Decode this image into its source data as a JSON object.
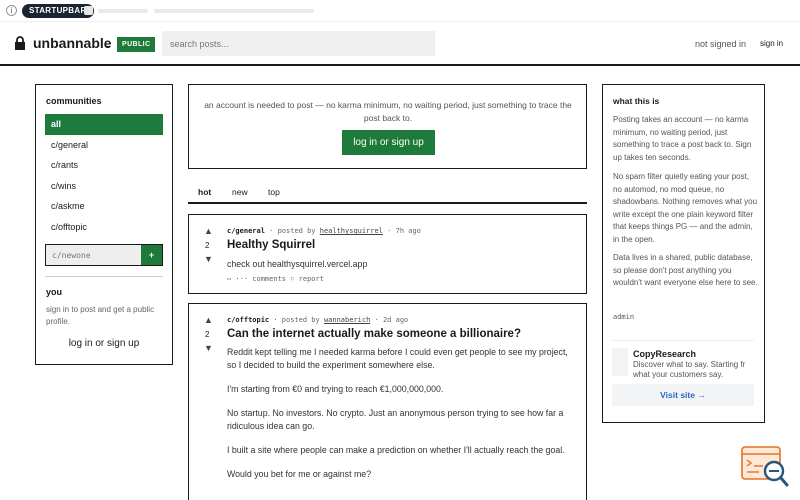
{
  "topbar": {
    "badge": "STARTUPBAR"
  },
  "header": {
    "site_name": "unbannable",
    "dot": ".",
    "public_badge": "PUBLIC",
    "search_placeholder": "search posts...",
    "status": "not signed in",
    "sign_in": "sign in"
  },
  "sidebar": {
    "title": "communities",
    "items": [
      {
        "label": "all",
        "active": true
      },
      {
        "label": "c/general"
      },
      {
        "label": "c/rants"
      },
      {
        "label": "c/wins"
      },
      {
        "label": "c/askme"
      },
      {
        "label": "c/offtopic"
      }
    ],
    "new_placeholder": "c/newone",
    "new_button": "+",
    "you_title": "you",
    "you_text": "sign in to post and get a public profile.",
    "login": "log in or sign up"
  },
  "notice": {
    "text": "an account is needed to post — no karma minimum, no waiting period, just something to trace the post back to.",
    "button": "log in or sign up"
  },
  "tabs": [
    {
      "label": "hot",
      "active": true
    },
    {
      "label": "new"
    },
    {
      "label": "top"
    }
  ],
  "posts": [
    {
      "score": "2",
      "community": "c/general",
      "posted_by": "· posted by",
      "author": "healthysquirrel",
      "time": "· 7h ago",
      "title": "Healthy Squirrel",
      "body": [
        "check out healthysquirrel.vercel.app"
      ],
      "actions": "⋯ ··· comments   ⚐ report"
    },
    {
      "score": "2",
      "community": "c/offtopic",
      "posted_by": "· posted by",
      "author": "wannaberich",
      "time": "· 2d ago",
      "title": "Can the internet actually make someone a billionaire?",
      "body": [
        "Reddit kept telling me I needed karma before I could even get people to see my project, so I decided to build the experiment somewhere else.",
        "I'm starting from €0 and trying to reach €1,000,000,000.",
        "No startup. No investors. No crypto. Just an anonymous person trying to see how far a ridiculous idea can go.",
        "I built a site where people can make a prediction on whether I'll actually reach the goal.",
        "Would you bet for me or against me?"
      ]
    }
  ],
  "about": {
    "title": "what this is",
    "paragraphs": [
      "Posting takes an account — no karma minimum, no waiting period, just something to trace a post back to. Sign up takes ten seconds.",
      "No spam filter quietly eating your post, no automod, no mod queue, no shadowbans. Nothing removes what you write except the one plain keyword filter that keeps things PG — and the admin, in the open.",
      "Data lives in a shared, public database, so please don't post anything you wouldn't want everyone else here to see."
    ],
    "admin": "admin"
  },
  "ad": {
    "name": "CopyResearch",
    "desc": [
      "Discover what to say. Starting fr",
      "what your customers say."
    ],
    "link": "Visit site →"
  },
  "colors": {
    "accent": "#1e7a3a",
    "link": "#2f66c8",
    "floater": "#e8702a"
  }
}
